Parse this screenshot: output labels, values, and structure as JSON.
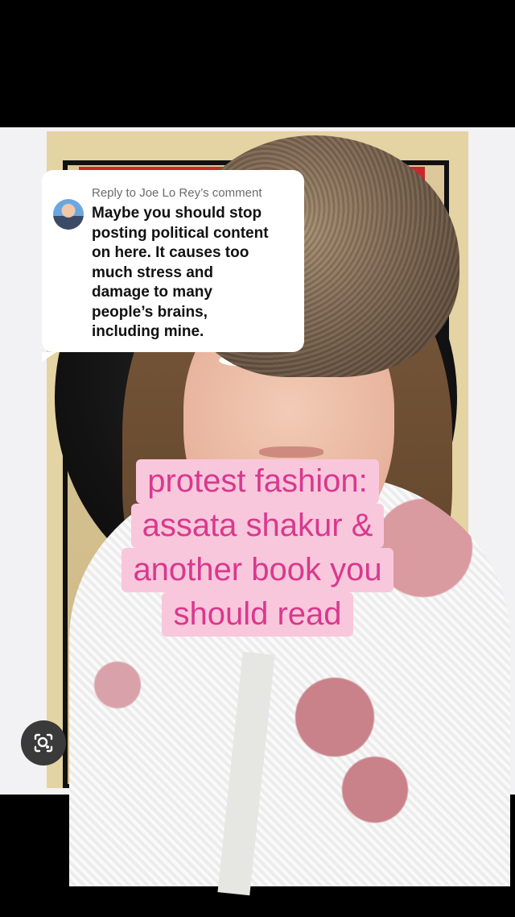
{
  "reply": {
    "header": "Reply to Joe Lo Rey’s comment",
    "lines": [
      "Maybe you should stop",
      "posting political content",
      "on here. It causes too",
      "much stress and",
      "damage to many",
      "people’s brains,",
      "including mine."
    ]
  },
  "caption": {
    "lines": [
      "protest fashion:",
      "assata shakur &",
      "another book you",
      "should read"
    ]
  },
  "lens": {
    "icon": "lens-search-icon"
  },
  "colors": {
    "caption_text": "#d9388e",
    "caption_bg": "#f9c7dc",
    "reply_bg": "#ffffff"
  }
}
